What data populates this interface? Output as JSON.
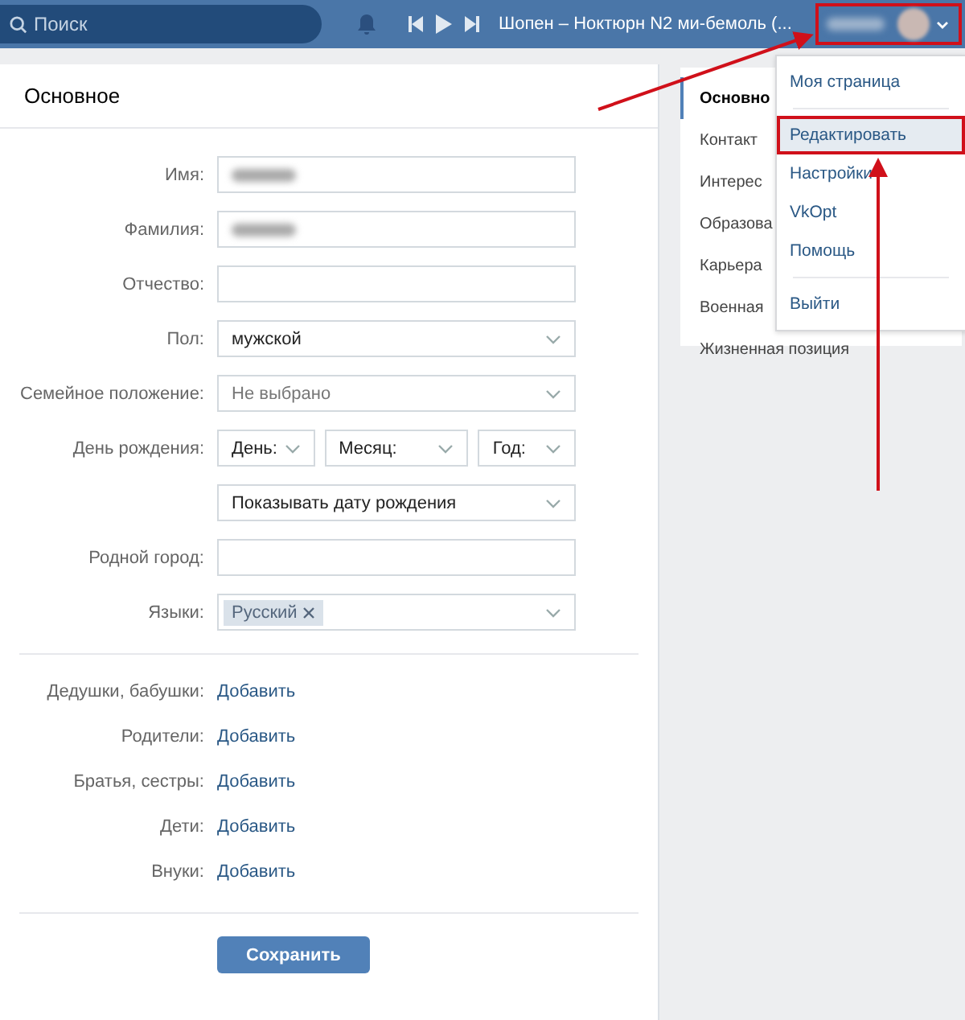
{
  "topbar": {
    "search": {
      "placeholder": "Поиск"
    },
    "track": "Шопен – Ноктюрн N2 ми-бемоль (...",
    "user": {
      "highlighted": true
    }
  },
  "card": {
    "title": "Основное",
    "fields": [
      {
        "kind": "text",
        "label": "Имя:",
        "blurred": true
      },
      {
        "kind": "text",
        "label": "Фамилия:",
        "blurred": true
      },
      {
        "kind": "text",
        "label": "Отчество:",
        "blurred": false
      },
      {
        "kind": "select",
        "label": "Пол:",
        "value": "мужской"
      },
      {
        "kind": "select",
        "label": "Семейное положение:",
        "placeholder": "Не выбрано"
      },
      {
        "kind": "date",
        "label": "День рождения:",
        "parts": [
          "День:",
          "Месяц:",
          "Год:"
        ]
      },
      {
        "kind": "select",
        "value": "Показывать дату рождения"
      },
      {
        "kind": "text",
        "label": "Родной город:",
        "blurred": false
      },
      {
        "kind": "tags",
        "label": "Языки:",
        "tags": [
          "Русский"
        ]
      }
    ],
    "relatives": [
      {
        "label": "Дедушки, бабушки:",
        "action": "Добавить"
      },
      {
        "label": "Родители:",
        "action": "Добавить"
      },
      {
        "label": "Братья, сестры:",
        "action": "Добавить"
      },
      {
        "label": "Дети:",
        "action": "Добавить"
      },
      {
        "label": "Внуки:",
        "action": "Добавить"
      }
    ],
    "save": "Сохранить"
  },
  "side_menu": [
    {
      "label": "Основно",
      "selected": true
    },
    {
      "label": "Контакт",
      "selected": false
    },
    {
      "label": "Интерес",
      "selected": false
    },
    {
      "label": "Образова",
      "selected": false
    },
    {
      "label": "Карьера",
      "selected": false
    },
    {
      "label": "Военная",
      "selected": false
    },
    {
      "label": "Жизненная позиция",
      "selected": false
    }
  ],
  "dropdown": [
    [
      {
        "label": "Моя страница",
        "selected": false,
        "highlighted": false
      }
    ],
    [
      {
        "label": "Редактировать",
        "selected": true,
        "highlighted": true
      },
      {
        "label": "Настройки",
        "selected": false,
        "highlighted": false
      },
      {
        "label": "VkOpt",
        "selected": false,
        "highlighted": false
      },
      {
        "label": "Помощь",
        "selected": false,
        "highlighted": false
      }
    ],
    [
      {
        "label": "Выйти",
        "selected": false,
        "highlighted": false
      }
    ]
  ]
}
